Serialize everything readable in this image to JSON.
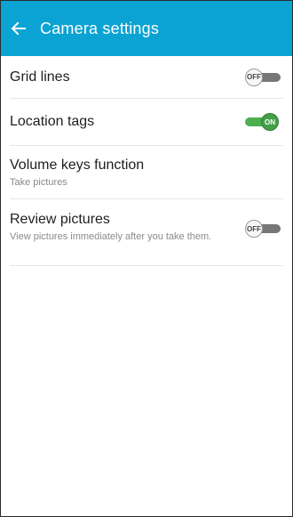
{
  "header": {
    "title": "Camera settings",
    "back_icon": "arrow-left-icon"
  },
  "settings": [
    {
      "label": "Grid lines",
      "toggle_text": "OFF",
      "state": "off"
    },
    {
      "label": "Location tags",
      "toggle_text": "ON",
      "state": "on"
    },
    {
      "label": "Volume keys function",
      "sub": "Take pictures"
    },
    {
      "label": "Review pictures",
      "sub": "View pictures immediately after you take them.",
      "toggle_text": "OFF",
      "state": "off"
    }
  ],
  "colors": {
    "appbar": "#0aa3d3",
    "toggle_on": "#4caf50",
    "toggle_off": "#777777"
  }
}
